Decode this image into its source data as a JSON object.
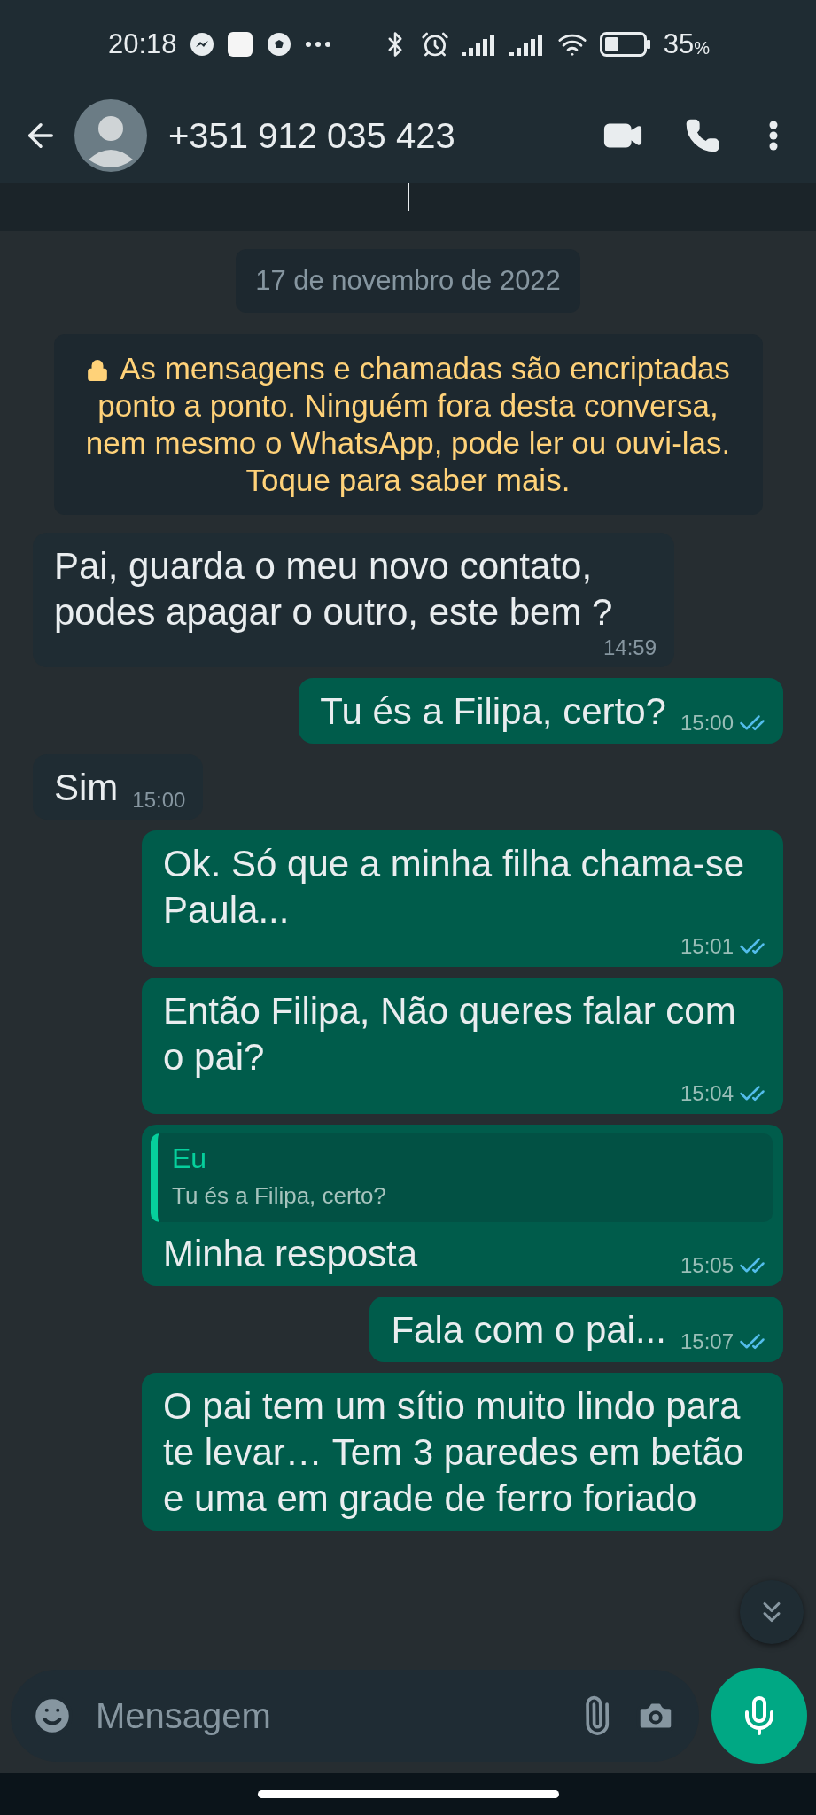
{
  "status_bar": {
    "time": "20:18",
    "battery": "35",
    "battery_unit": "%"
  },
  "header": {
    "title": "+351 912 035 423"
  },
  "date_chip": "17 de novembro de 2022",
  "encryption_notice": "As mensagens e chamadas são encriptadas ponto a ponto. Ninguém fora desta conversa, nem mesmo o WhatsApp, pode ler ou ouvi-las. Toque para saber mais.",
  "messages": [
    {
      "kind": "incoming",
      "text": "Pai, guarda o meu novo contato, podes apagar o outro, este bem ?",
      "time": "14:59"
    },
    {
      "kind": "outgoing",
      "text": "Tu és a Filipa, certo?",
      "time": "15:00",
      "read": true
    },
    {
      "kind": "incoming",
      "text": "Sim",
      "time": "15:00"
    },
    {
      "kind": "outgoing",
      "text": "Ok. Só que a minha filha chama-se Paula...",
      "time": "15:01",
      "read": true
    },
    {
      "kind": "outgoing",
      "text": "Então Filipa, Não queres falar com o pai?",
      "time": "15:04",
      "read": true
    },
    {
      "kind": "reply",
      "quote_author": "Eu",
      "quote_text": "Tu és a Filipa, certo?",
      "text": "Minha resposta",
      "time": "15:05",
      "read": true
    },
    {
      "kind": "outgoing",
      "text": "Fala com o pai...",
      "time": "15:07",
      "read": true
    },
    {
      "kind": "outgoing",
      "text": "O pai tem um sítio muito lindo para te levar… Tem 3 paredes em betão e uma em grade de ferro foriado"
    }
  ],
  "composer": {
    "placeholder": "Mensagem"
  }
}
